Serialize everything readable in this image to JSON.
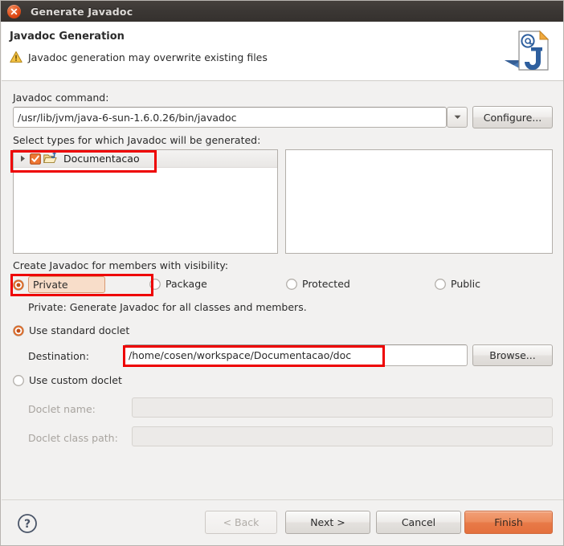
{
  "window": {
    "title": "Generate Javadoc",
    "close_icon": "close-icon"
  },
  "header": {
    "title": "Javadoc Generation",
    "warning_icon": "warning-triangle-icon",
    "message": "Javadoc generation may overwrite existing files",
    "brand_icon": "javadoc-document-icon"
  },
  "command": {
    "label": "Javadoc command:",
    "value": "/usr/lib/jvm/java-6-sun-1.6.0.26/bin/javadoc",
    "dropdown_icon": "chevron-down-icon",
    "configure_label": "Configure..."
  },
  "types": {
    "label": "Select types for which Javadoc will be generated:",
    "tree": [
      {
        "label": "Documentacao",
        "expand_icon": "chevron-right-icon",
        "checkbox_icon": "checkbox-checked-icon",
        "folder_icon": "java-project-folder-icon",
        "checked": true,
        "selected": true
      }
    ],
    "members": []
  },
  "visibility": {
    "label": "Create Javadoc for members with visibility:",
    "options": [
      {
        "label": "Private",
        "selected": true
      },
      {
        "label": "Package",
        "selected": false
      },
      {
        "label": "Protected",
        "selected": false
      },
      {
        "label": "Public",
        "selected": false
      }
    ],
    "description": "Private: Generate Javadoc for all classes and members."
  },
  "doclet": {
    "standard_label": "Use standard doclet",
    "standard_selected": true,
    "destination_label": "Destination:",
    "destination_value": "/home/cosen/workspace/Documentacao/doc",
    "browse_label": "Browse...",
    "custom_label": "Use custom doclet",
    "custom_selected": false,
    "doclet_name_label": "Doclet name:",
    "doclet_name_value": "",
    "doclet_classpath_label": "Doclet class path:",
    "doclet_classpath_value": ""
  },
  "footer": {
    "help_icon": "help-question-icon",
    "back_label": "< Back",
    "back_disabled": true,
    "next_label": "Next >",
    "cancel_label": "Cancel",
    "finish_label": "Finish"
  },
  "colors": {
    "accent_orange": "#dd4814",
    "finish_button": "#e87a48",
    "annotation_red": "#ee0000",
    "titlebar": "#3b3734",
    "dialog_bg": "#f2f1f0"
  }
}
